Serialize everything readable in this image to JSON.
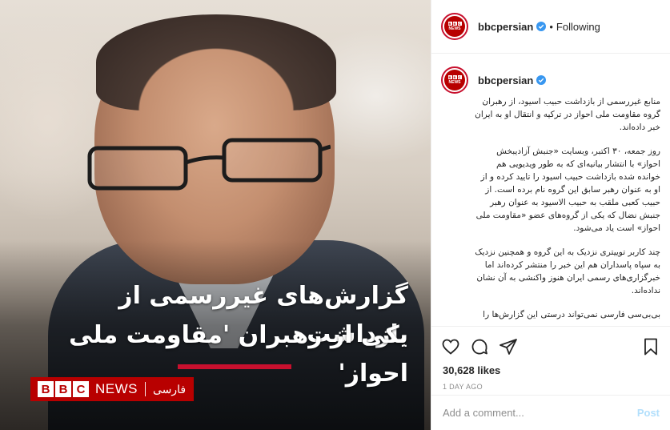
{
  "post": {
    "headline_line1": "گزارش‌های غیررسمی از بازداشت",
    "headline_line2": "یکی از رهبران 'مقاومت ملی احواز'",
    "badge": {
      "bbc_letters": [
        "B",
        "B",
        "C"
      ],
      "news": "NEWS",
      "language": "فارسی"
    },
    "brand_color": "#b80000"
  },
  "header": {
    "username": "bbcpersian",
    "separator": "•",
    "follow_status": "Following",
    "verified": true
  },
  "caption": {
    "username": "bbcpersian",
    "paragraphs": [
      "منابع غیررسمی از بازداشت حبیب اسیود، از رهبران گروه مقاومت ملی احواز در ترکیه و انتقال او به ایران خبر داده‌اند.",
      "روز جمعه، ۳۰ اکتبر، وبسایت «جنبش آزادیبخش احواز» با انتشار بیانیه‌ای که به طور ویدیویی هم خوانده شده بازداشت حبیب اسیود را تایید کرده و از او به عنوان رهبر سابق این گروه نام برده است. از حبیب کعبی ملقب به حبیب الاسیود به عنوان رهبر جنبش نضال که یکی از گروه‌های عضو «مقاومت ملی احواز» است یاد می‌شود.",
      "چند کاربر توییتری نزدیک به این گروه و همچنین نزدیک به سپاه پاسداران هم این خبر را منتشر کرده‌اند اما خبرگزاری‌های رسمی ایران هنوز واکنشی به آن نشان نداده‌اند.",
      "بی‌بی‌سی فارسی نمی‌تواند درستی این گزارش‌ها را"
    ]
  },
  "actions": {
    "icons": [
      "heart-icon",
      "comment-icon",
      "share-icon",
      "bookmark-icon"
    ]
  },
  "likes": "30,628 likes",
  "timestamp": "1 DAY AGO",
  "comment": {
    "placeholder": "Add a comment...",
    "post_label": "Post"
  }
}
